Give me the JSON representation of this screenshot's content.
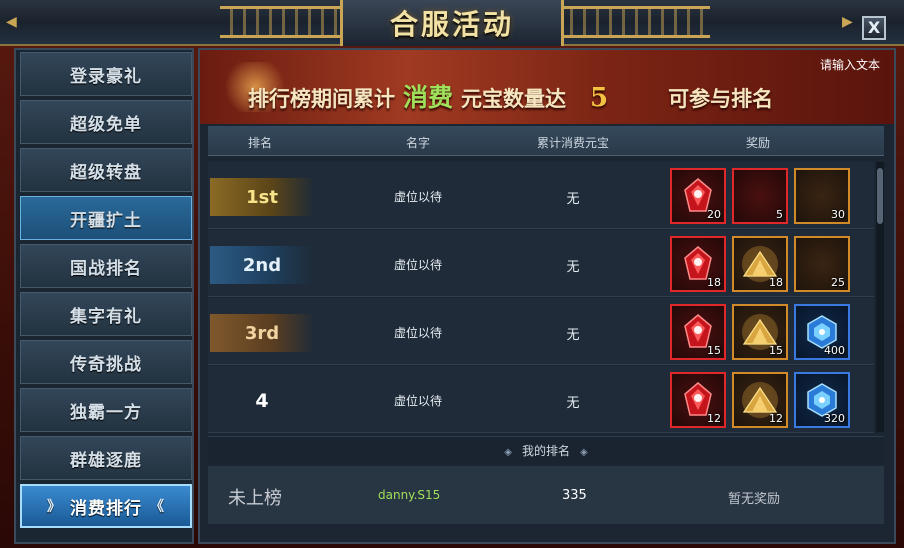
{
  "window": {
    "title": "合服活动",
    "close_label": "X"
  },
  "sidebar": {
    "items": [
      {
        "label": "登录豪礼",
        "state": "normal"
      },
      {
        "label": "超级免单",
        "state": "normal"
      },
      {
        "label": "超级转盘",
        "state": "normal"
      },
      {
        "label": "开疆扩土",
        "state": "special"
      },
      {
        "label": "国战排名",
        "state": "normal"
      },
      {
        "label": "集字有礼",
        "state": "normal"
      },
      {
        "label": "传奇挑战",
        "state": "normal"
      },
      {
        "label": "独霸一方",
        "state": "normal"
      },
      {
        "label": "群雄逐鹿",
        "state": "normal"
      },
      {
        "label": "消费排行",
        "state": "active"
      }
    ],
    "active_left_glyph": "》",
    "active_right_glyph": "《"
  },
  "banner": {
    "input_hint": "请输入文本",
    "text_prefix": "排行榜期间累计",
    "highlight": "消费",
    "text_middle": "元宝数量达",
    "threshold": "5",
    "text_suffix": "可参与排名"
  },
  "table": {
    "headers": {
      "rank": "排名",
      "name": "名字",
      "spent": "累计消费元宝",
      "reward": "奖励"
    },
    "rows": [
      {
        "rank": "1st",
        "style": "gold",
        "name": "虚位以待",
        "spent": "无",
        "rewards": [
          {
            "icon": "red-gem-icon",
            "frame": "red",
            "qty": "20"
          },
          {
            "icon": "empty-slot",
            "frame": "red",
            "qty": "5"
          },
          {
            "icon": "empty-slot",
            "frame": "orange",
            "qty": "30"
          }
        ]
      },
      {
        "rank": "2nd",
        "style": "blue",
        "name": "虚位以待",
        "spent": "无",
        "rewards": [
          {
            "icon": "red-gem-icon",
            "frame": "red",
            "qty": "18"
          },
          {
            "icon": "gold-pile-icon",
            "frame": "orange",
            "qty": "18"
          },
          {
            "icon": "empty-slot",
            "frame": "orange",
            "qty": "25"
          }
        ]
      },
      {
        "rank": "3rd",
        "style": "bronze",
        "name": "虚位以待",
        "spent": "无",
        "rewards": [
          {
            "icon": "red-gem-icon",
            "frame": "red",
            "qty": "15"
          },
          {
            "icon": "gold-pile-icon",
            "frame": "orange",
            "qty": "15"
          },
          {
            "icon": "blue-crystal-icon",
            "frame": "blue",
            "qty": "400"
          }
        ]
      },
      {
        "rank": "4",
        "style": "plain",
        "name": "虚位以待",
        "spent": "无",
        "rewards": [
          {
            "icon": "red-gem-icon",
            "frame": "red",
            "qty": "12"
          },
          {
            "icon": "gold-pile-icon",
            "frame": "orange",
            "qty": "12"
          },
          {
            "icon": "blue-crystal-icon",
            "frame": "blue",
            "qty": "320"
          }
        ]
      }
    ]
  },
  "my_rank": {
    "section_title": "我的排名",
    "rank": "未上榜",
    "name": "danny.S15",
    "spent": "335",
    "reward": "暂无奖励"
  },
  "colors": {
    "accent_gold": "#c9a555",
    "highlight_green": "#9fe05a",
    "threshold_gold": "#f4c242",
    "active_tab_blue": "#3a8ad0"
  }
}
